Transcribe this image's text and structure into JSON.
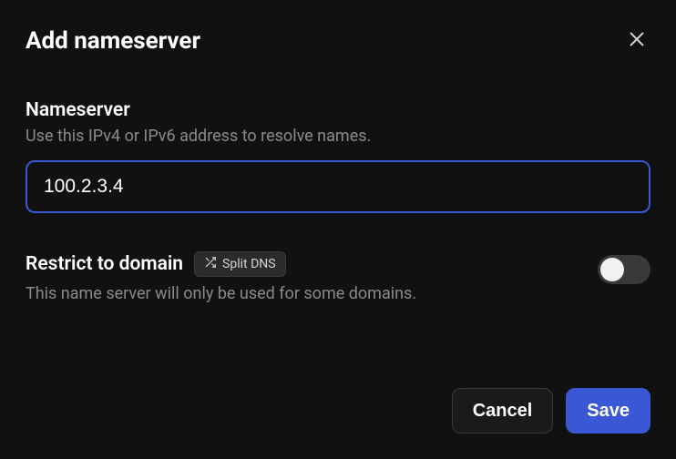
{
  "dialog": {
    "title": "Add nameserver"
  },
  "nameserver": {
    "label": "Nameserver",
    "hint": "Use this IPv4 or IPv6 address to resolve names.",
    "value": "100.2.3.4"
  },
  "restrict": {
    "title": "Restrict to domain",
    "badge": "Split DNS",
    "hint": "This name server will only be used for some domains.",
    "enabled": false
  },
  "footer": {
    "cancel": "Cancel",
    "save": "Save"
  }
}
